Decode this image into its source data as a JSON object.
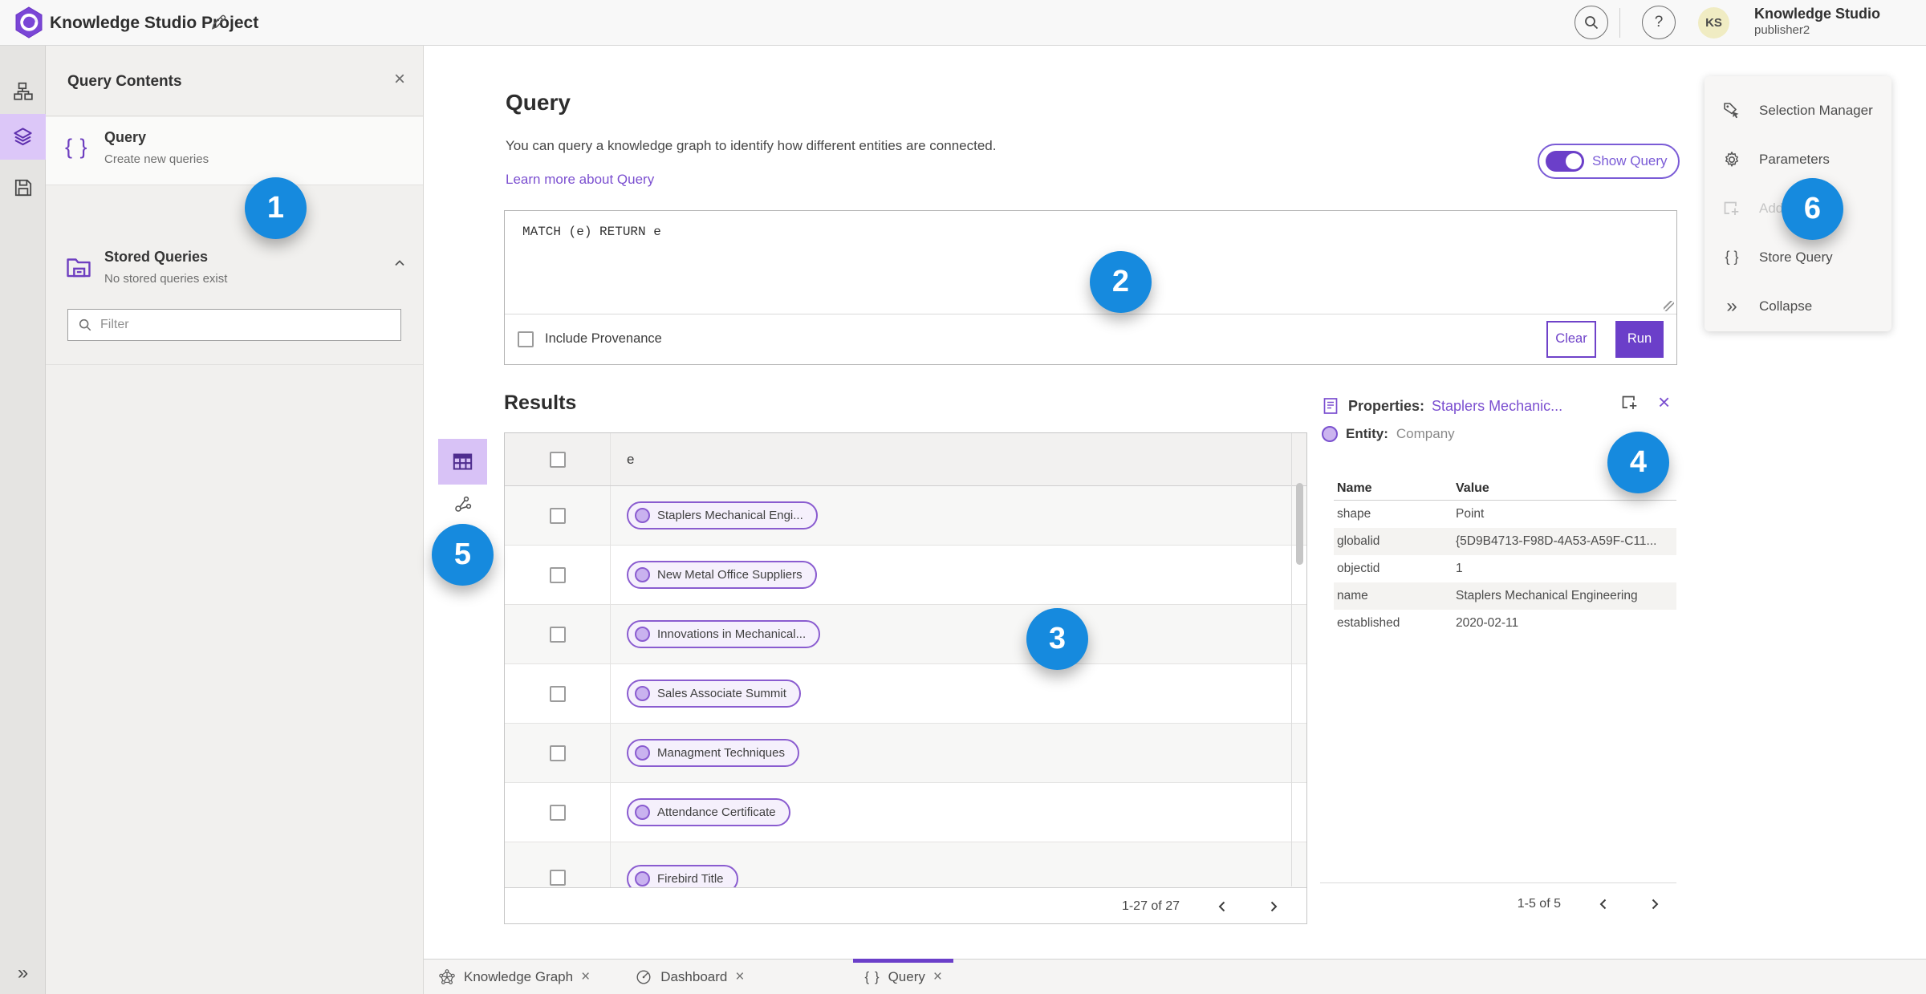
{
  "app": {
    "title": "Knowledge Studio Project",
    "user_name": "Knowledge Studio",
    "user_role": "publisher2",
    "avatar_initials": "KS",
    "help_glyph": "?"
  },
  "icons": {
    "close_glyph": "×",
    "collapse_glyph": "»",
    "expand_rail_glyph": "»",
    "braces_glyph": "{ }"
  },
  "contents_panel": {
    "title": "Query Contents",
    "query_item": {
      "title": "Query",
      "subtitle": "Create new queries"
    },
    "stored_item": {
      "title": "Stored Queries",
      "subtitle": "No stored queries exist"
    },
    "filter_placeholder": "Filter"
  },
  "query_section": {
    "heading": "Query",
    "description": "You can query a knowledge graph to identify how different entities are connected.",
    "learn_more": "Learn more about Query",
    "show_query_label": "Show Query",
    "query_text": "MATCH (e) RETURN e",
    "include_provenance_label": "Include Provenance",
    "clear_label": "Clear",
    "run_label": "Run"
  },
  "results": {
    "heading": "Results",
    "column_header": "e",
    "rows": [
      "Staplers Mechanical Engi...",
      "New Metal Office Suppliers",
      "Innovations in Mechanical...",
      "Sales Associate Summit",
      "Managment Techniques",
      "Attendance Certificate",
      "Firebird Title"
    ],
    "pagination": "1-27 of 27"
  },
  "properties": {
    "label": "Properties:",
    "selected_entity": "Staplers Mechanic...",
    "entity_label": "Entity:",
    "entity_type": "Company",
    "col_name": "Name",
    "col_value": "Value",
    "rows": [
      {
        "name": "shape",
        "value": "Point"
      },
      {
        "name": "globalid",
        "value": "{5D9B4713-F98D-4A53-A59F-C11..."
      },
      {
        "name": "objectid",
        "value": "1"
      },
      {
        "name": "name",
        "value": "Staplers Mechanical Engineering"
      },
      {
        "name": "established",
        "value": "2020-02-11"
      }
    ],
    "pagination": "1-5 of 5"
  },
  "side_menu": {
    "selection_manager": "Selection Manager",
    "parameters": "Parameters",
    "add_to_map": "Add To Map",
    "store_query": "Store Query",
    "collapse": "Collapse"
  },
  "tabs": [
    {
      "label": "Knowledge Graph"
    },
    {
      "label": "Dashboard"
    },
    {
      "label": "Query"
    }
  ],
  "badges": [
    "1",
    "2",
    "3",
    "4",
    "5",
    "6"
  ],
  "colors": {
    "accent_purple": "#6b3fc9",
    "link_purple": "#7b4fd0",
    "selection_purple": "#dcc7f8",
    "badge_blue": "#168ade",
    "chip_border": "#8a5cd0"
  }
}
